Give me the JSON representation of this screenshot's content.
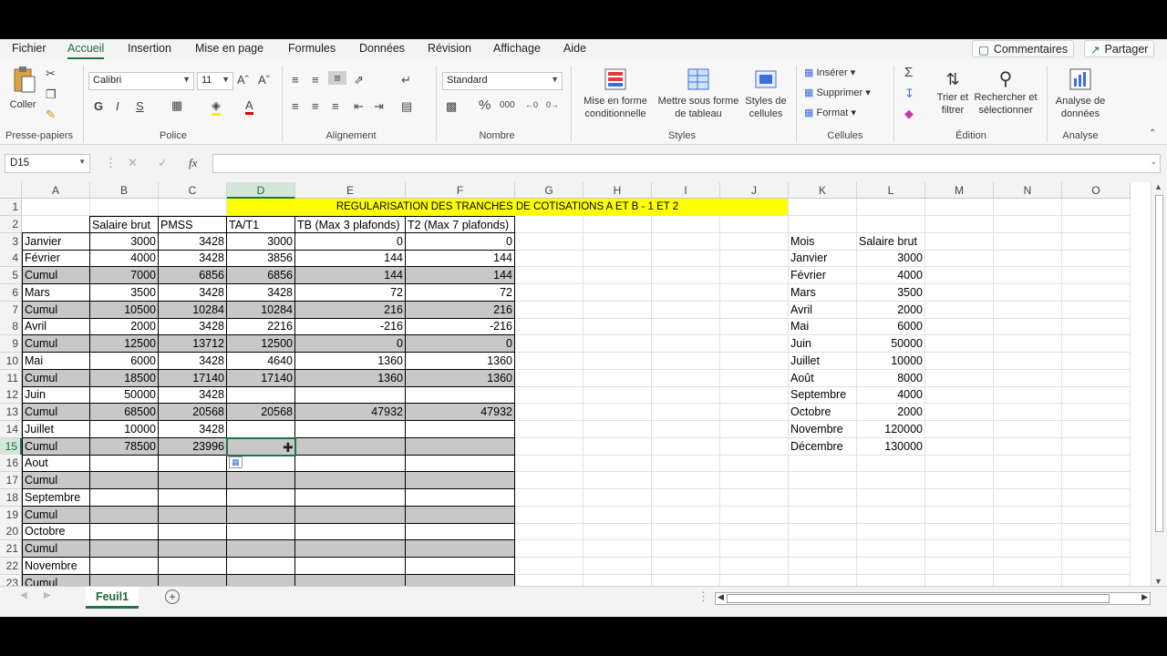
{
  "menu": {
    "tabs": [
      "Fichier",
      "Accueil",
      "Insertion",
      "Mise en page",
      "Formules",
      "Données",
      "Révision",
      "Affichage",
      "Aide"
    ],
    "comments": "Commentaires",
    "share": "Partager"
  },
  "ribbon": {
    "paste": "Coller",
    "clipboard": "Presse-papiers",
    "font_name": "Calibri",
    "font_size": "11",
    "font_group": "Police",
    "bold": "G",
    "italic": "I",
    "underline": "S",
    "alignment": "Alignement",
    "number_format": "Standard",
    "number": "Nombre",
    "cond_format_1": "Mise en forme",
    "cond_format_2": "conditionnelle",
    "table_format_1": "Mettre sous forme",
    "table_format_2": "de tableau",
    "cell_styles_1": "Styles de",
    "cell_styles_2": "cellules",
    "styles": "Styles",
    "insert": "Insérer",
    "delete": "Supprimer",
    "format": "Format",
    "cells": "Cellules",
    "sort_1": "Trier et",
    "sort_2": "filtrer",
    "find_1": "Rechercher et",
    "find_2": "sélectionner",
    "editing": "Édition",
    "analyze_1": "Analyse de",
    "analyze_2": "données",
    "analysis": "Analyse"
  },
  "formula_bar": {
    "name_box": "D15",
    "fx": "fx",
    "formula": ""
  },
  "columns": [
    "A",
    "B",
    "C",
    "D",
    "E",
    "F",
    "G",
    "H",
    "I",
    "J",
    "K",
    "L",
    "M",
    "N",
    "O"
  ],
  "rows": [
    "1",
    "2",
    "3",
    "4",
    "5",
    "6",
    "7",
    "8",
    "9",
    "10",
    "11",
    "12",
    "13",
    "14",
    "15",
    "16",
    "17",
    "18",
    "19",
    "20",
    "21",
    "22",
    "23"
  ],
  "title_banner": "REGULARISATION DES TRANCHES DE COTISATIONS A ET B - 1 ET 2",
  "headers": [
    "",
    "Salaire brut",
    "PMSS",
    "TA/T1",
    "TB (Max 3 plafonds)",
    "T2 (Max 7 plafonds)"
  ],
  "table": [
    [
      "Janvier",
      "3000",
      "3428",
      "3000",
      "0",
      "0"
    ],
    [
      "Février",
      "4000",
      "3428",
      "3856",
      "144",
      "144"
    ],
    [
      "Cumul",
      "7000",
      "6856",
      "6856",
      "144",
      "144"
    ],
    [
      "Mars",
      "3500",
      "3428",
      "3428",
      "72",
      "72"
    ],
    [
      "Cumul",
      "10500",
      "10284",
      "10284",
      "216",
      "216"
    ],
    [
      "Avril",
      "2000",
      "3428",
      "2216",
      "-216",
      "-216"
    ],
    [
      "Cumul",
      "12500",
      "13712",
      "12500",
      "0",
      "0"
    ],
    [
      "Mai",
      "6000",
      "3428",
      "4640",
      "1360",
      "1360"
    ],
    [
      "Cumul",
      "18500",
      "17140",
      "17140",
      "1360",
      "1360"
    ],
    [
      "Juin",
      "50000",
      "3428",
      "",
      "",
      ""
    ],
    [
      "Cumul",
      "68500",
      "20568",
      "20568",
      "47932",
      "47932"
    ],
    [
      "Juillet",
      "10000",
      "3428",
      "",
      "",
      ""
    ],
    [
      "Cumul",
      "78500",
      "23996",
      "",
      "",
      ""
    ],
    [
      "Aout",
      "",
      "",
      "",
      "",
      ""
    ],
    [
      "Cumul",
      "",
      "",
      "",
      "",
      ""
    ],
    [
      "Septembre",
      "",
      "",
      "",
      "",
      ""
    ],
    [
      "Cumul",
      "",
      "",
      "",
      "",
      ""
    ],
    [
      "Octobre",
      "",
      "",
      "",
      "",
      ""
    ],
    [
      "Cumul",
      "",
      "",
      "",
      "",
      ""
    ],
    [
      "Novembre",
      "",
      "",
      "",
      "",
      ""
    ],
    [
      "Cumul",
      "",
      "",
      "",
      "",
      ""
    ]
  ],
  "side_table": {
    "headers": [
      "Mois",
      "Salaire brut"
    ],
    "rows": [
      [
        "Janvier",
        "3000"
      ],
      [
        "Février",
        "4000"
      ],
      [
        "Mars",
        "3500"
      ],
      [
        "Avril",
        "2000"
      ],
      [
        "Mai",
        "6000"
      ],
      [
        "Juin",
        "50000"
      ],
      [
        "Juillet",
        "10000"
      ],
      [
        "Août",
        "8000"
      ],
      [
        "Septembre",
        "4000"
      ],
      [
        "Octobre",
        "2000"
      ],
      [
        "Novembre",
        "120000"
      ],
      [
        "Décembre",
        "130000"
      ]
    ]
  },
  "sheet_tab": "Feuil1",
  "selected_cell": "D15"
}
